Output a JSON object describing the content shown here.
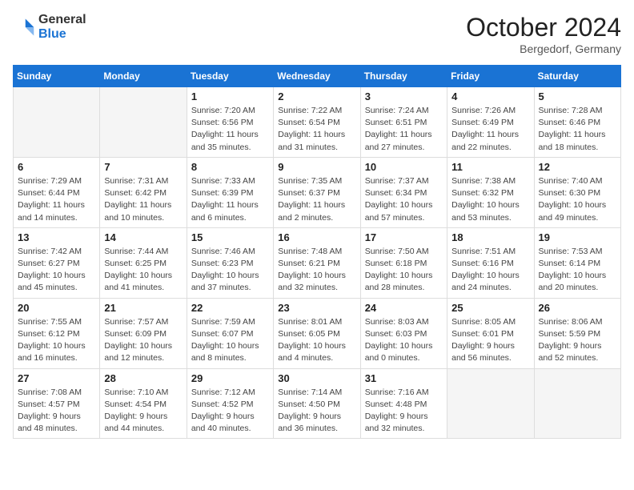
{
  "header": {
    "logo_general": "General",
    "logo_blue": "Blue",
    "month_title": "October 2024",
    "location": "Bergedorf, Germany"
  },
  "weekdays": [
    "Sunday",
    "Monday",
    "Tuesday",
    "Wednesday",
    "Thursday",
    "Friday",
    "Saturday"
  ],
  "weeks": [
    [
      {
        "day": "",
        "detail": ""
      },
      {
        "day": "",
        "detail": ""
      },
      {
        "day": "1",
        "detail": "Sunrise: 7:20 AM\nSunset: 6:56 PM\nDaylight: 11 hours\nand 35 minutes."
      },
      {
        "day": "2",
        "detail": "Sunrise: 7:22 AM\nSunset: 6:54 PM\nDaylight: 11 hours\nand 31 minutes."
      },
      {
        "day": "3",
        "detail": "Sunrise: 7:24 AM\nSunset: 6:51 PM\nDaylight: 11 hours\nand 27 minutes."
      },
      {
        "day": "4",
        "detail": "Sunrise: 7:26 AM\nSunset: 6:49 PM\nDaylight: 11 hours\nand 22 minutes."
      },
      {
        "day": "5",
        "detail": "Sunrise: 7:28 AM\nSunset: 6:46 PM\nDaylight: 11 hours\nand 18 minutes."
      }
    ],
    [
      {
        "day": "6",
        "detail": "Sunrise: 7:29 AM\nSunset: 6:44 PM\nDaylight: 11 hours\nand 14 minutes."
      },
      {
        "day": "7",
        "detail": "Sunrise: 7:31 AM\nSunset: 6:42 PM\nDaylight: 11 hours\nand 10 minutes."
      },
      {
        "day": "8",
        "detail": "Sunrise: 7:33 AM\nSunset: 6:39 PM\nDaylight: 11 hours\nand 6 minutes."
      },
      {
        "day": "9",
        "detail": "Sunrise: 7:35 AM\nSunset: 6:37 PM\nDaylight: 11 hours\nand 2 minutes."
      },
      {
        "day": "10",
        "detail": "Sunrise: 7:37 AM\nSunset: 6:34 PM\nDaylight: 10 hours\nand 57 minutes."
      },
      {
        "day": "11",
        "detail": "Sunrise: 7:38 AM\nSunset: 6:32 PM\nDaylight: 10 hours\nand 53 minutes."
      },
      {
        "day": "12",
        "detail": "Sunrise: 7:40 AM\nSunset: 6:30 PM\nDaylight: 10 hours\nand 49 minutes."
      }
    ],
    [
      {
        "day": "13",
        "detail": "Sunrise: 7:42 AM\nSunset: 6:27 PM\nDaylight: 10 hours\nand 45 minutes."
      },
      {
        "day": "14",
        "detail": "Sunrise: 7:44 AM\nSunset: 6:25 PM\nDaylight: 10 hours\nand 41 minutes."
      },
      {
        "day": "15",
        "detail": "Sunrise: 7:46 AM\nSunset: 6:23 PM\nDaylight: 10 hours\nand 37 minutes."
      },
      {
        "day": "16",
        "detail": "Sunrise: 7:48 AM\nSunset: 6:21 PM\nDaylight: 10 hours\nand 32 minutes."
      },
      {
        "day": "17",
        "detail": "Sunrise: 7:50 AM\nSunset: 6:18 PM\nDaylight: 10 hours\nand 28 minutes."
      },
      {
        "day": "18",
        "detail": "Sunrise: 7:51 AM\nSunset: 6:16 PM\nDaylight: 10 hours\nand 24 minutes."
      },
      {
        "day": "19",
        "detail": "Sunrise: 7:53 AM\nSunset: 6:14 PM\nDaylight: 10 hours\nand 20 minutes."
      }
    ],
    [
      {
        "day": "20",
        "detail": "Sunrise: 7:55 AM\nSunset: 6:12 PM\nDaylight: 10 hours\nand 16 minutes."
      },
      {
        "day": "21",
        "detail": "Sunrise: 7:57 AM\nSunset: 6:09 PM\nDaylight: 10 hours\nand 12 minutes."
      },
      {
        "day": "22",
        "detail": "Sunrise: 7:59 AM\nSunset: 6:07 PM\nDaylight: 10 hours\nand 8 minutes."
      },
      {
        "day": "23",
        "detail": "Sunrise: 8:01 AM\nSunset: 6:05 PM\nDaylight: 10 hours\nand 4 minutes."
      },
      {
        "day": "24",
        "detail": "Sunrise: 8:03 AM\nSunset: 6:03 PM\nDaylight: 10 hours\nand 0 minutes."
      },
      {
        "day": "25",
        "detail": "Sunrise: 8:05 AM\nSunset: 6:01 PM\nDaylight: 9 hours\nand 56 minutes."
      },
      {
        "day": "26",
        "detail": "Sunrise: 8:06 AM\nSunset: 5:59 PM\nDaylight: 9 hours\nand 52 minutes."
      }
    ],
    [
      {
        "day": "27",
        "detail": "Sunrise: 7:08 AM\nSunset: 4:57 PM\nDaylight: 9 hours\nand 48 minutes."
      },
      {
        "day": "28",
        "detail": "Sunrise: 7:10 AM\nSunset: 4:54 PM\nDaylight: 9 hours\nand 44 minutes."
      },
      {
        "day": "29",
        "detail": "Sunrise: 7:12 AM\nSunset: 4:52 PM\nDaylight: 9 hours\nand 40 minutes."
      },
      {
        "day": "30",
        "detail": "Sunrise: 7:14 AM\nSunset: 4:50 PM\nDaylight: 9 hours\nand 36 minutes."
      },
      {
        "day": "31",
        "detail": "Sunrise: 7:16 AM\nSunset: 4:48 PM\nDaylight: 9 hours\nand 32 minutes."
      },
      {
        "day": "",
        "detail": ""
      },
      {
        "day": "",
        "detail": ""
      }
    ]
  ]
}
